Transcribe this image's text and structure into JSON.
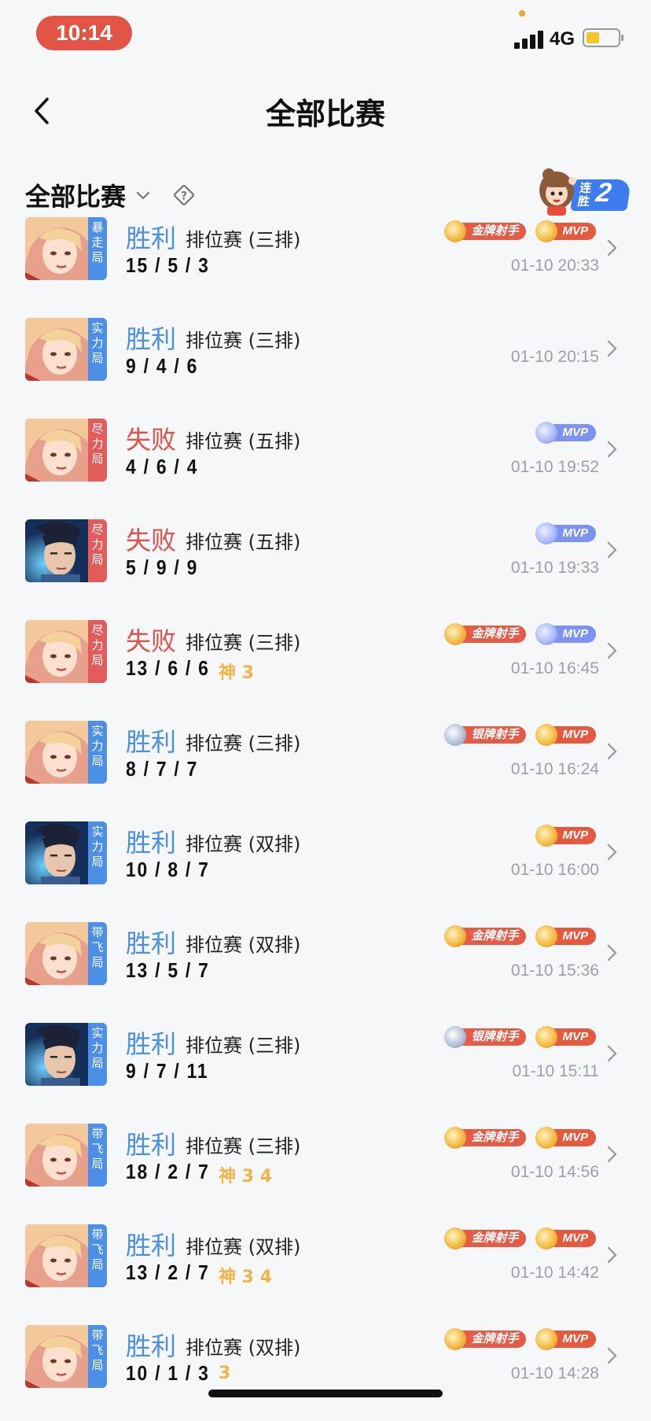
{
  "status_bar": {
    "time": "10:14",
    "network": "4G"
  },
  "nav": {
    "title": "全部比赛"
  },
  "filter": {
    "label": "全部比赛",
    "streak_label": "连胜",
    "streak_count": "2"
  },
  "colors": {
    "win": "#4a8fe0",
    "loss": "#e0504b",
    "mode_red": "#e35c5c",
    "mode_blue": "#4b8fe6",
    "gold_badge": "#e65a48",
    "silver_badge": "#e65a48",
    "mvp_gold": "#e45a3e",
    "mvp_blue": "#7c93f0"
  },
  "matches": [
    {
      "hero": "female",
      "mode": "暴走局",
      "mode_color": "blue",
      "result": "胜利",
      "win": true,
      "type": "排位赛 (三排)",
      "kda": "15 / 5 / 3",
      "extras": "",
      "badges": [
        {
          "kind": "gold",
          "label": "金牌射手"
        },
        {
          "kind": "mvp_gold",
          "label": "MVP"
        }
      ],
      "time": "01-10 20:33"
    },
    {
      "hero": "female",
      "mode": "实力局",
      "mode_color": "blue",
      "result": "胜利",
      "win": true,
      "type": "排位赛 (三排)",
      "kda": "9 / 4 / 6",
      "extras": "",
      "badges": [],
      "time": "01-10 20:15"
    },
    {
      "hero": "female",
      "mode": "尽力局",
      "mode_color": "red",
      "result": "失败",
      "win": false,
      "type": "排位赛 (五排)",
      "kda": "4 / 6 / 4",
      "extras": "",
      "badges": [
        {
          "kind": "mvp_blue",
          "label": "MVP"
        }
      ],
      "time": "01-10 19:52"
    },
    {
      "hero": "male",
      "mode": "尽力局",
      "mode_color": "red",
      "result": "失败",
      "win": false,
      "type": "排位赛 (五排)",
      "kda": "5 / 9 / 9",
      "extras": "",
      "badges": [
        {
          "kind": "mvp_blue",
          "label": "MVP"
        }
      ],
      "time": "01-10 19:33"
    },
    {
      "hero": "female",
      "mode": "尽力局",
      "mode_color": "red",
      "result": "失败",
      "win": false,
      "type": "排位赛 (三排)",
      "kda": "13 / 6 / 6",
      "extras": "神 3",
      "badges": [
        {
          "kind": "gold",
          "label": "金牌射手"
        },
        {
          "kind": "mvp_blue",
          "label": "MVP"
        }
      ],
      "time": "01-10 16:45"
    },
    {
      "hero": "female",
      "mode": "实力局",
      "mode_color": "blue",
      "result": "胜利",
      "win": true,
      "type": "排位赛 (三排)",
      "kda": "8 / 7 / 7",
      "extras": "",
      "badges": [
        {
          "kind": "silver",
          "label": "银牌射手"
        },
        {
          "kind": "mvp_gold",
          "label": "MVP"
        }
      ],
      "time": "01-10 16:24"
    },
    {
      "hero": "male",
      "mode": "实力局",
      "mode_color": "blue",
      "result": "胜利",
      "win": true,
      "type": "排位赛 (双排)",
      "kda": "10 / 8 / 7",
      "extras": "",
      "badges": [
        {
          "kind": "mvp_gold",
          "label": "MVP"
        }
      ],
      "time": "01-10 16:00"
    },
    {
      "hero": "female",
      "mode": "带飞局",
      "mode_color": "blue",
      "result": "胜利",
      "win": true,
      "type": "排位赛 (双排)",
      "kda": "13 / 5 / 7",
      "extras": "",
      "badges": [
        {
          "kind": "gold",
          "label": "金牌射手"
        },
        {
          "kind": "mvp_gold",
          "label": "MVP"
        }
      ],
      "time": "01-10 15:36"
    },
    {
      "hero": "male",
      "mode": "实力局",
      "mode_color": "blue",
      "result": "胜利",
      "win": true,
      "type": "排位赛 (三排)",
      "kda": "9 / 7 / 11",
      "extras": "",
      "badges": [
        {
          "kind": "silver",
          "label": "银牌射手"
        },
        {
          "kind": "mvp_gold",
          "label": "MVP"
        }
      ],
      "time": "01-10 15:11"
    },
    {
      "hero": "female",
      "mode": "带飞局",
      "mode_color": "blue",
      "result": "胜利",
      "win": true,
      "type": "排位赛 (三排)",
      "kda": "18 / 2 / 7",
      "extras": "神 3 4",
      "badges": [
        {
          "kind": "gold",
          "label": "金牌射手"
        },
        {
          "kind": "mvp_gold",
          "label": "MVP"
        }
      ],
      "time": "01-10 14:56"
    },
    {
      "hero": "female",
      "mode": "带飞局",
      "mode_color": "blue",
      "result": "胜利",
      "win": true,
      "type": "排位赛 (双排)",
      "kda": "13 / 2 / 7",
      "extras": "神 3 4",
      "badges": [
        {
          "kind": "gold",
          "label": "金牌射手"
        },
        {
          "kind": "mvp_gold",
          "label": "MVP"
        }
      ],
      "time": "01-10 14:42"
    },
    {
      "hero": "female",
      "mode": "带飞局",
      "mode_color": "blue",
      "result": "胜利",
      "win": true,
      "type": "排位赛 (双排)",
      "kda": "10 / 1 / 3",
      "extras": "3",
      "badges": [
        {
          "kind": "gold",
          "label": "金牌射手"
        },
        {
          "kind": "mvp_gold",
          "label": "MVP"
        }
      ],
      "time": "01-10 14:28"
    }
  ]
}
